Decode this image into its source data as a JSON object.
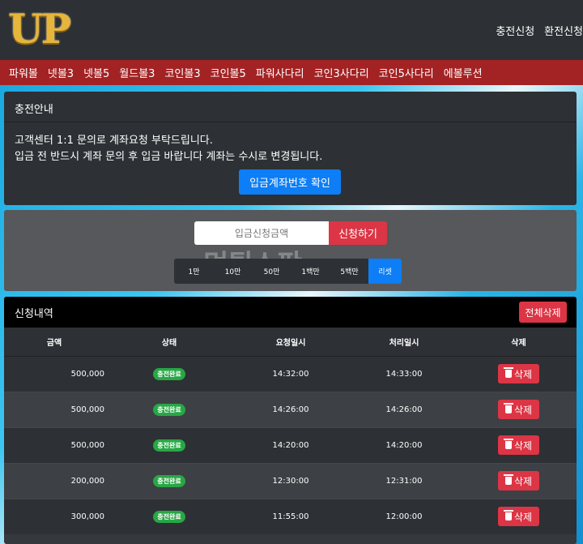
{
  "header": {
    "logo_text": "UP",
    "links": [
      "충전신청",
      "환전신청"
    ]
  },
  "nav": {
    "items": [
      "파워볼",
      "넷볼3",
      "넷볼5",
      "월드볼3",
      "코인볼3",
      "코인볼5",
      "파워사다리",
      "코인3사다리",
      "코인5사다리",
      "에볼루션"
    ]
  },
  "notice": {
    "title": "충전안내",
    "line1": "고객센터 1:1 문의로 계좌요청 부탁드립니다.",
    "line2": "입금 전 반드시 계좌 문의 후 입금 바랍니다 계좌는 수시로 변경됩니다.",
    "account_button": "입금계좌번호 확인"
  },
  "deposit_form": {
    "amount_placeholder": "입금신청금액",
    "apply_button": "신청하기",
    "quick_amounts": [
      "1만",
      "10만",
      "50만",
      "1백만",
      "5백만"
    ],
    "reset_label": "리셋",
    "watermark": "먹튀스팟"
  },
  "history": {
    "title": "신청내역",
    "delete_all": "전체삭제",
    "columns": [
      "금액",
      "상태",
      "요청일시",
      "처리일시",
      "삭제"
    ],
    "delete_label": "삭제",
    "rows": [
      {
        "amount": "500,000",
        "status": "충전완료",
        "requested": "14:32:00",
        "processed": "14:33:00"
      },
      {
        "amount": "500,000",
        "status": "충전완료",
        "requested": "14:26:00",
        "processed": "14:26:00"
      },
      {
        "amount": "500,000",
        "status": "충전완료",
        "requested": "14:20:00",
        "processed": "14:20:00"
      },
      {
        "amount": "200,000",
        "status": "충전완료",
        "requested": "12:30:00",
        "processed": "12:31:00"
      },
      {
        "amount": "300,000",
        "status": "충전완료",
        "requested": "11:55:00",
        "processed": "12:00:00"
      }
    ]
  },
  "colors": {
    "header_bg": "#2d3034",
    "nav_bg": "#a32324",
    "primary": "#0d7ef5",
    "danger": "#dc3545",
    "success": "#28a745",
    "logo_gold": "#e6b53c"
  }
}
